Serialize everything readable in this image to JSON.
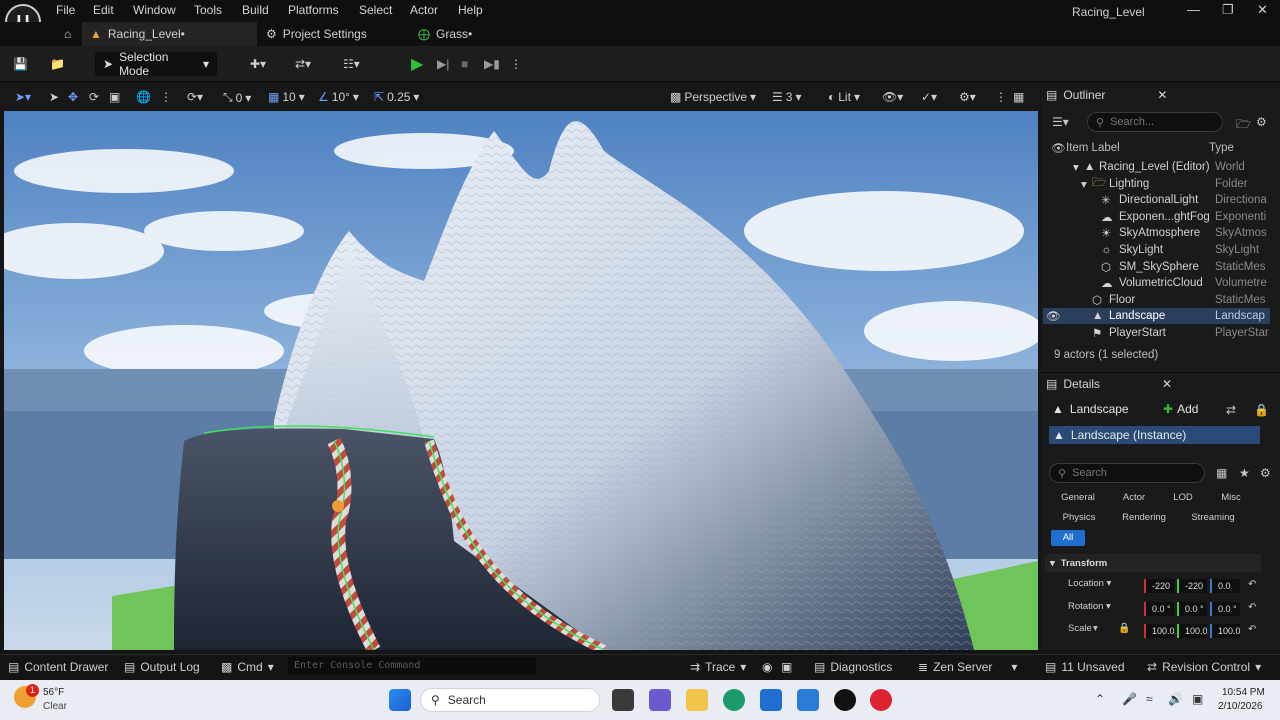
{
  "app": {
    "logo": "U",
    "window_title": "Racing_Level"
  },
  "menu": {
    "items": [
      "File",
      "Edit",
      "Window",
      "Tools",
      "Build",
      "Platforms",
      "Select",
      "Actor",
      "Help"
    ]
  },
  "tabs": [
    {
      "label": "Racing_Level•"
    },
    {
      "label": "Project Settings"
    },
    {
      "label": "Grass•"
    }
  ],
  "toolbar": {
    "selection_mode": "Selection Mode"
  },
  "viewport_toolbar": {
    "translate_snap": "0",
    "grid_size": "10",
    "rotation_snap": "10°",
    "scale_snap": "0.25",
    "view_mode": "Perspective",
    "camera_speed": "3",
    "lighting": "Lit"
  },
  "outliner": {
    "title": "Outliner",
    "search_placeholder": "Search...",
    "col_label": "Item Label",
    "col_type": "Type",
    "rows": [
      {
        "label": "Racing_Level (Editor)",
        "type": "World"
      },
      {
        "label": "Lighting",
        "type": "Folder"
      },
      {
        "label": "DirectionalLight",
        "type": "Directiona"
      },
      {
        "label": "Exponen...ghtFog",
        "type": "Exponenti"
      },
      {
        "label": "SkyAtmosphere",
        "type": "SkyAtmos"
      },
      {
        "label": "SkyLight",
        "type": "SkyLight"
      },
      {
        "label": "SM_SkySphere",
        "type": "StaticMes"
      },
      {
        "label": "VolumetricCloud",
        "type": "Volumetre"
      },
      {
        "label": "Floor",
        "type": "StaticMes"
      },
      {
        "label": "Landscape",
        "type": "Landscap"
      },
      {
        "label": "PlayerStart",
        "type": "PlayerStar"
      }
    ],
    "summary": "9 actors (1 selected)"
  },
  "details": {
    "title": "Details",
    "actor_name": "Landscape",
    "add_label": "Add",
    "instance_label": "Landscape (Instance)",
    "search_placeholder": "Search",
    "categories": [
      "General",
      "Actor",
      "LOD",
      "Misc",
      "Physics",
      "Rendering",
      "Streaming",
      "All"
    ],
    "section": "Transform",
    "location_label": "Location",
    "rotation_label": "Rotation",
    "scale_label": "Scale",
    "location": [
      "-220",
      "-220",
      "0.0"
    ],
    "rotation": [
      "0.0 °",
      "0.0 °",
      "0.0 °"
    ],
    "scale": [
      "100.0",
      "100.0",
      "100.0"
    ]
  },
  "statusbar": {
    "content_drawer": "Content Drawer",
    "output_log": "Output Log",
    "cmd": "Cmd",
    "console_placeholder": "Enter Console Command",
    "trace": "Trace",
    "diagnostics": "Diagnostics",
    "zen_server": "Zen Server",
    "unsaved": "11 Unsaved",
    "revision_control": "Revision Control"
  },
  "taskbar": {
    "weather_temp": "56°F",
    "weather_desc": "Clear",
    "weather_badge": "1",
    "search": "Search",
    "time": "10:54 PM",
    "date": "2/10/2026"
  },
  "colors": {
    "accent": "#1f6fd1",
    "play": "#2fbf3a",
    "selection": "#2a3f5c"
  }
}
